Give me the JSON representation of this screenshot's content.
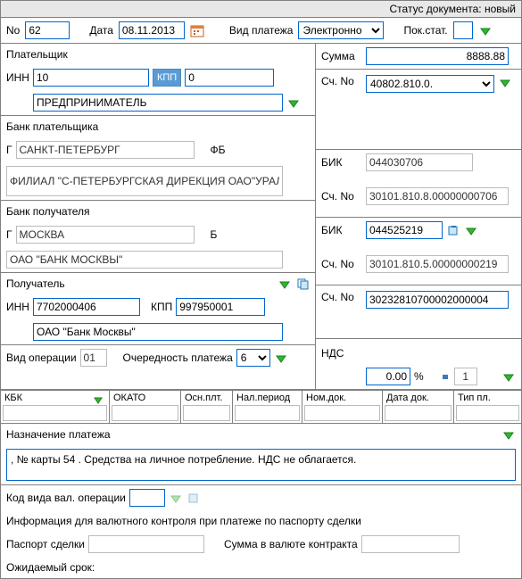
{
  "status": {
    "label": "Статус документа:",
    "value": "новый"
  },
  "header": {
    "no_label": "No",
    "no_value": "62",
    "date_label": "Дата",
    "date_value": "08.11.2013",
    "payment_type_label": "Вид платежа",
    "payment_type_value": "Электронно",
    "pok_stat_label": "Пок.стат.",
    "pok_stat_value": ""
  },
  "payer": {
    "title": "Плательщик",
    "inn_label": "ИНН",
    "inn_value": "10",
    "kpp_btn": "КПП",
    "kpp_value": "0",
    "name": "ПРЕДПРИНИМАТЕЛЬ",
    "bank_title": "Банк плательщика",
    "city_label": "Г",
    "city": "САНКТ-ПЕТЕРБУРГ",
    "fb_label": "ФБ",
    "bank_name": "ФИЛИАЛ \"С-ПЕТЕРБУРГСКАЯ ДИРЕКЦИЯ ОАО\"УРАЛСИБ\""
  },
  "payee_bank": {
    "title": "Банк получателя",
    "city_label": "Г",
    "city": "МОСКВА",
    "b_label": "Б",
    "bank_name": "ОАО \"БАНК МОСКВЫ\""
  },
  "payee": {
    "title": "Получатель",
    "inn_label": "ИНН",
    "inn_value": "7702000406",
    "kpp_label": "КПП",
    "kpp_value": "997950001",
    "name": "ОАО \"Банк Москвы\""
  },
  "op": {
    "type_label": "Вид операции",
    "type_value": "01",
    "priority_label": "Очередность платежа",
    "priority_value": "6"
  },
  "amounts": {
    "sum_label": "Сумма",
    "sum_value": "8888.88",
    "acc1_label": "Сч. No",
    "acc1_value": "40802.810.0.",
    "bik1_label": "БИК",
    "bik1_value": "044030706",
    "bank_acc1_label": "Сч. No",
    "bank_acc1_value": "30101.810.8.00000000706",
    "bik2_label": "БИК",
    "bik2_value": "044525219",
    "bank_acc2_label": "Сч. No",
    "bank_acc2_value": "30101.810.5.00000000219",
    "acc2_label": "Сч. No",
    "acc2_value": "30232810700002000004",
    "nds_label": "НДС",
    "nds_rate": "0.00",
    "percent": "%",
    "nds_kind": "1"
  },
  "budget": {
    "kbk_label": "КБК",
    "okato_label": "ОКАТО",
    "osn_label": "Осн.плт.",
    "period_label": "Нал.период",
    "nomdok_label": "Ном.док.",
    "datadok_label": "Дата док.",
    "tippl_label": "Тип пл."
  },
  "purpose": {
    "title": "Назначение платежа",
    "text": ", № карты 54                       . Средства на личное потребление. НДС не облагается."
  },
  "currency": {
    "code_label": "Код вида вал. операции",
    "code_value": "",
    "info_label": "Информация для валютного контроля при платеже по паспорту сделки",
    "passport_label": "Паспорт сделки",
    "passport_value": "",
    "sum_label": "Сумма в валюте контракта",
    "sum_value": "",
    "expected_label": "Ожидаемый срок:"
  }
}
